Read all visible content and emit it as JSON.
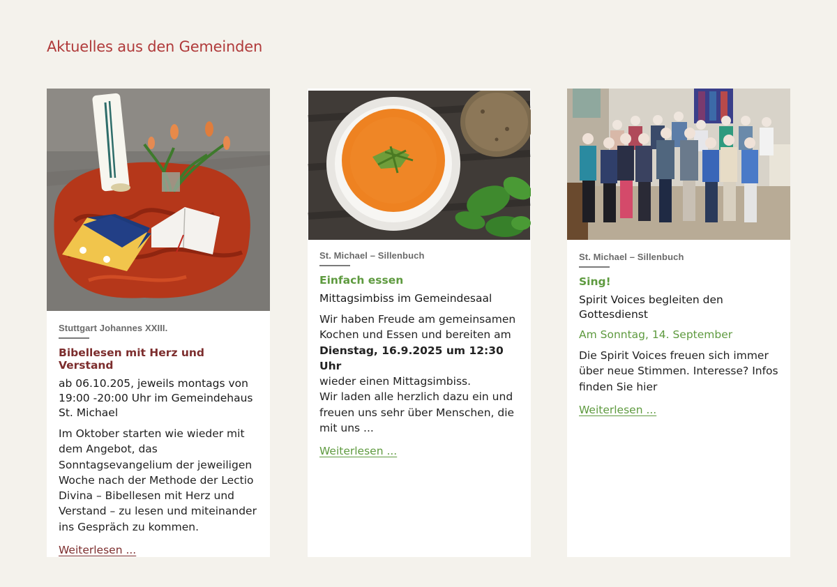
{
  "section": {
    "title": "Aktuelles aus den Gemeinden"
  },
  "cards": [
    {
      "parish": "Stuttgart Johannes XXIII.",
      "kicker": "Bibellesen mit Herz und Verstand",
      "headline": "ab 06.10.205, jeweils montags von 19:00 -20:00 Uhr im Gemeindehaus St. Michael",
      "body": "Im Oktober starten wie wieder mit dem Angebot, das Sonntagsevangelium der jeweiligen Woche nach der Methode der Lectio Divina – Bibellesen mit Herz und Verstand – zu lesen und miteinander ins Gespräch zu kommen.",
      "read_more": "Weiterlesen ...",
      "image": "candle-bible-altar-photo"
    },
    {
      "parish": "St. Michael – Sillenbuch",
      "kicker": "Einfach essen",
      "headline": "Mittagsimbiss im Gemeindesaal",
      "body_before": "Wir haben Freude am gemeinsamen Kochen und Essen und bereiten am",
      "body_bold": "Dienstag, 16.9.2025 um 12:30 Uhr",
      "body_after_1": "wieder einen Mittagsimbiss.",
      "body_after_2": "Wir laden alle herzlich dazu ein und freuen uns sehr über Menschen, die mit uns  ...",
      "read_more": "Weiterlesen ...",
      "image": "tomato-soup-photo"
    },
    {
      "parish": "St. Michael – Sillenbuch",
      "kicker": "Sing!",
      "headline": "Spirit Voices begleiten den Gottesdienst",
      "dateline": "Am Sonntag, 14. September",
      "body": "Die Spirit Voices freuen sich immer über neue Stimmen. Interesse? Infos finden Sie hier",
      "read_more": "Weiterlesen ...",
      "image": "choir-group-photo"
    }
  ],
  "colors": {
    "background": "#f4f2ec",
    "title_red": "#b03a3a",
    "dark_red": "#7c2d2d",
    "green": "#5e9a3f"
  }
}
